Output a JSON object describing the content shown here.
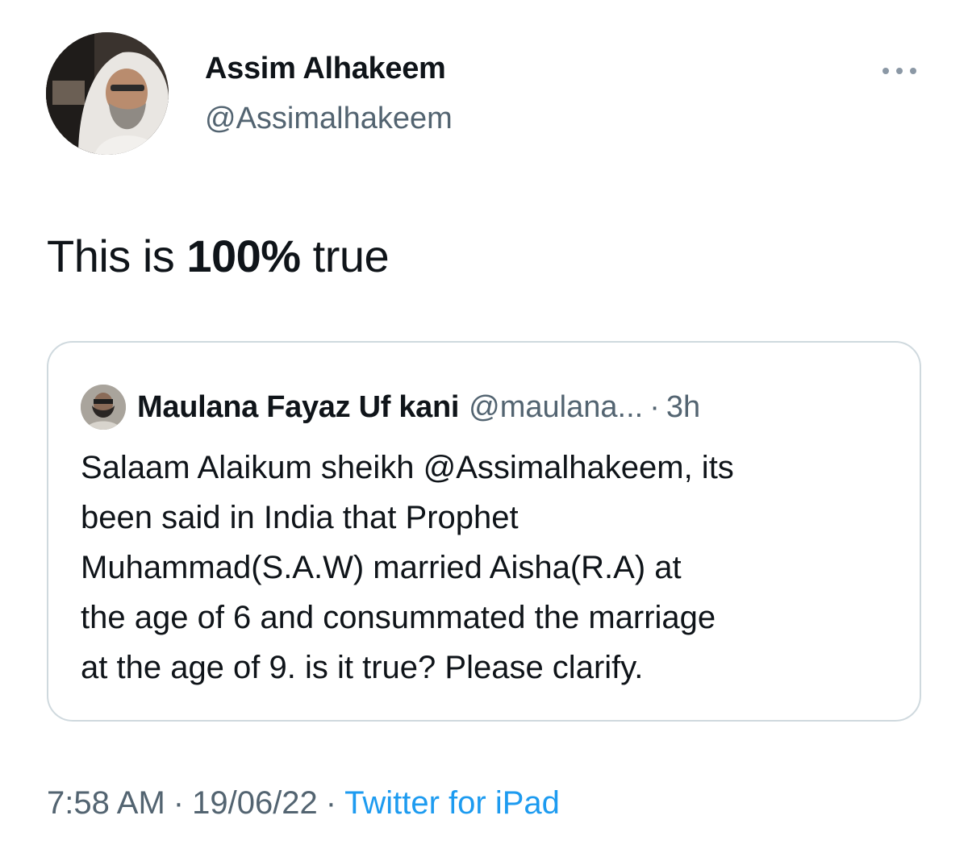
{
  "author": {
    "name": "Assim Alhakeem",
    "handle": "@Assimalhakeem"
  },
  "tweet": {
    "text_before": "This is ",
    "text_bold": "100%",
    "text_after": " true"
  },
  "quoted_tweet": {
    "name": "Maulana Fayaz Uf kani",
    "handle": "@maulana...",
    "separator": "·",
    "time": "3h",
    "body_lines": [
      "Salaam Alaikum sheikh @Assimalhakeem, its",
      "been said in India that Prophet",
      "Muhammad(S.A.W) married Aisha(R.A) at",
      "the age of 6 and consummated the marriage",
      "at the age of 9. is it true? Please clarify."
    ]
  },
  "meta": {
    "time": "7:58 AM",
    "sep": "·",
    "date": "19/06/22",
    "source": "Twitter for iPad"
  },
  "colors": {
    "text": "#0f1419",
    "secondary": "#536471",
    "link": "#1d9bf0",
    "border": "#cfd9de"
  },
  "icons": {
    "more": "more-dots-icon"
  }
}
